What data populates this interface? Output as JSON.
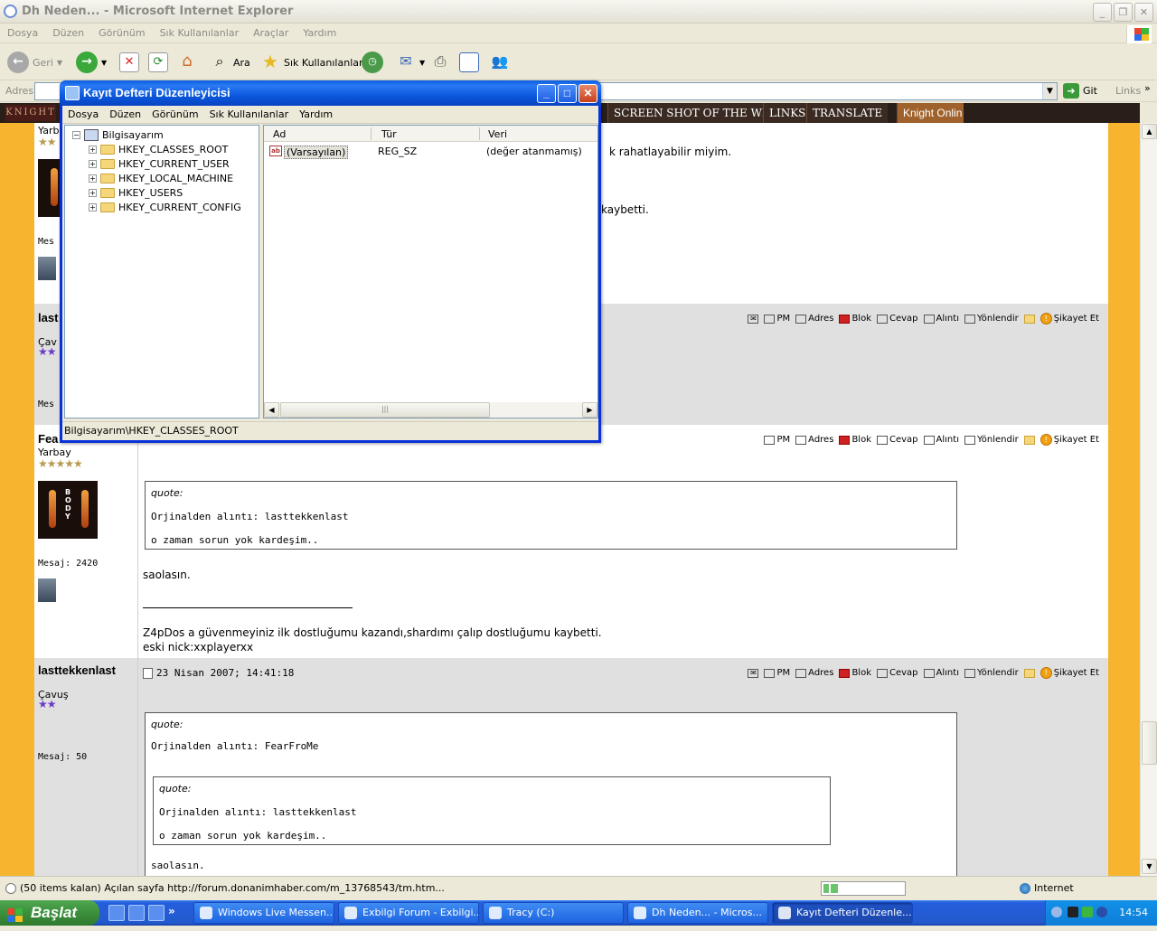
{
  "ie": {
    "title": "Dh Neden... - Microsoft Internet Explorer",
    "menu": [
      "Dosya",
      "Düzen",
      "Görünüm",
      "Sık Kullanılanlar",
      "Araçlar",
      "Yardım"
    ],
    "toolbar": {
      "back": "Geri",
      "search": "Ara",
      "favorites": "Sık Kullanılanlar"
    },
    "address_label": "Adres",
    "address_value": "h",
    "go": "Git",
    "links": "Links"
  },
  "site_nav": {
    "logo": "KNIGHT",
    "items": [
      "SCREEN SHOT OF THE WEEK",
      "LINKS",
      "TRANSLATE",
      "Knight Onlin"
    ]
  },
  "forum": {
    "post1": {
      "rank_partial": "Yarb",
      "mesaj_partial": "Mes",
      "line1": "k rahatlayabilir miyim.",
      "line2": "kaybetti."
    },
    "post2": {
      "author_partial": "last",
      "rank_partial": "Çav",
      "mesaj_partial": "Mes"
    },
    "post3": {
      "author_partial": "Fea",
      "rank": "Yarbay",
      "mesaj": "Mesaj: 2420",
      "quote_head": "quote:",
      "quote_author": "Orjinalden alıntı: lasttekkenlast",
      "quote_text": "o zaman sorun yok kardeşim..",
      "reply": "saolasın.",
      "sig1": "Z4pDos a güvenmeyiniz ilk dostluğumu kazandı,shardımı çalıp dostluğumu kaybetti.",
      "sig2": "eski nick:xxplayerxx"
    },
    "post4": {
      "author": "lasttekkenlast",
      "date": "23 Nisan 2007; 14:41:18",
      "rank": "Çavuş",
      "mesaj": "Mesaj: 50",
      "quote_head": "quote:",
      "quote_author": "Orjinalden alıntı: FearFroMe",
      "inner_quote_head": "quote:",
      "inner_quote_author": "Orjinalden alıntı: lasttekkenlast",
      "inner_quote_text": "o zaman sorun yok kardeşim..",
      "reply": "saolasın."
    },
    "actions": [
      "PM",
      "Adres",
      "Blok",
      "Cevap",
      "Alıntı",
      "Yönlendir",
      "Şikayet Et"
    ]
  },
  "status": {
    "text": "(50 items kalan) Açılan sayfa http://forum.donanimhaber.com/m_13768543/tm.htm...",
    "zone": "Internet"
  },
  "regedit": {
    "title": "Kayıt Defteri Düzenleyicisi",
    "menu": [
      "Dosya",
      "Düzen",
      "Görünüm",
      "Sık Kullanılanlar",
      "Yardım"
    ],
    "root": "Bilgisayarım",
    "keys": [
      "HKEY_CLASSES_ROOT",
      "HKEY_CURRENT_USER",
      "HKEY_LOCAL_MACHINE",
      "HKEY_USERS",
      "HKEY_CURRENT_CONFIG"
    ],
    "columns": [
      "Ad",
      "Tür",
      "Veri"
    ],
    "row": {
      "name": "(Varsayılan)",
      "type": "REG_SZ",
      "data": "(değer atanmamış)",
      "icon": "ab"
    },
    "statusbar": "Bilgisayarım\\HKEY_CLASSES_ROOT"
  },
  "taskbar": {
    "start": "Başlat",
    "tasks": [
      "Windows Live Messen...",
      "Exbilgi Forum - Exbilgi...",
      "Tracy (C:)",
      "Dh Neden... - Micros...",
      "Kayıt Defteri Düzenle..."
    ],
    "clock": "14:54"
  }
}
